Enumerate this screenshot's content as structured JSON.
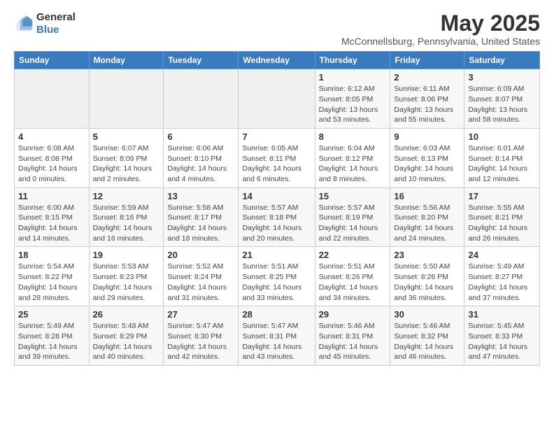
{
  "logo": {
    "general": "General",
    "blue": "Blue"
  },
  "title": "May 2025",
  "subtitle": "McConnellsburg, Pennsylvania, United States",
  "days_of_week": [
    "Sunday",
    "Monday",
    "Tuesday",
    "Wednesday",
    "Thursday",
    "Friday",
    "Saturday"
  ],
  "weeks": [
    [
      {
        "day": "",
        "info": ""
      },
      {
        "day": "",
        "info": ""
      },
      {
        "day": "",
        "info": ""
      },
      {
        "day": "",
        "info": ""
      },
      {
        "day": "1",
        "info": "Sunrise: 6:12 AM\nSunset: 8:05 PM\nDaylight: 13 hours and 53 minutes."
      },
      {
        "day": "2",
        "info": "Sunrise: 6:11 AM\nSunset: 8:06 PM\nDaylight: 13 hours and 55 minutes."
      },
      {
        "day": "3",
        "info": "Sunrise: 6:09 AM\nSunset: 8:07 PM\nDaylight: 13 hours and 58 minutes."
      }
    ],
    [
      {
        "day": "4",
        "info": "Sunrise: 6:08 AM\nSunset: 8:08 PM\nDaylight: 14 hours and 0 minutes."
      },
      {
        "day": "5",
        "info": "Sunrise: 6:07 AM\nSunset: 8:09 PM\nDaylight: 14 hours and 2 minutes."
      },
      {
        "day": "6",
        "info": "Sunrise: 6:06 AM\nSunset: 8:10 PM\nDaylight: 14 hours and 4 minutes."
      },
      {
        "day": "7",
        "info": "Sunrise: 6:05 AM\nSunset: 8:11 PM\nDaylight: 14 hours and 6 minutes."
      },
      {
        "day": "8",
        "info": "Sunrise: 6:04 AM\nSunset: 8:12 PM\nDaylight: 14 hours and 8 minutes."
      },
      {
        "day": "9",
        "info": "Sunrise: 6:03 AM\nSunset: 8:13 PM\nDaylight: 14 hours and 10 minutes."
      },
      {
        "day": "10",
        "info": "Sunrise: 6:01 AM\nSunset: 8:14 PM\nDaylight: 14 hours and 12 minutes."
      }
    ],
    [
      {
        "day": "11",
        "info": "Sunrise: 6:00 AM\nSunset: 8:15 PM\nDaylight: 14 hours and 14 minutes."
      },
      {
        "day": "12",
        "info": "Sunrise: 5:59 AM\nSunset: 8:16 PM\nDaylight: 14 hours and 16 minutes."
      },
      {
        "day": "13",
        "info": "Sunrise: 5:58 AM\nSunset: 8:17 PM\nDaylight: 14 hours and 18 minutes."
      },
      {
        "day": "14",
        "info": "Sunrise: 5:57 AM\nSunset: 8:18 PM\nDaylight: 14 hours and 20 minutes."
      },
      {
        "day": "15",
        "info": "Sunrise: 5:57 AM\nSunset: 8:19 PM\nDaylight: 14 hours and 22 minutes."
      },
      {
        "day": "16",
        "info": "Sunrise: 5:56 AM\nSunset: 8:20 PM\nDaylight: 14 hours and 24 minutes."
      },
      {
        "day": "17",
        "info": "Sunrise: 5:55 AM\nSunset: 8:21 PM\nDaylight: 14 hours and 26 minutes."
      }
    ],
    [
      {
        "day": "18",
        "info": "Sunrise: 5:54 AM\nSunset: 8:22 PM\nDaylight: 14 hours and 28 minutes."
      },
      {
        "day": "19",
        "info": "Sunrise: 5:53 AM\nSunset: 8:23 PM\nDaylight: 14 hours and 29 minutes."
      },
      {
        "day": "20",
        "info": "Sunrise: 5:52 AM\nSunset: 8:24 PM\nDaylight: 14 hours and 31 minutes."
      },
      {
        "day": "21",
        "info": "Sunrise: 5:51 AM\nSunset: 8:25 PM\nDaylight: 14 hours and 33 minutes."
      },
      {
        "day": "22",
        "info": "Sunrise: 5:51 AM\nSunset: 8:26 PM\nDaylight: 14 hours and 34 minutes."
      },
      {
        "day": "23",
        "info": "Sunrise: 5:50 AM\nSunset: 8:26 PM\nDaylight: 14 hours and 36 minutes."
      },
      {
        "day": "24",
        "info": "Sunrise: 5:49 AM\nSunset: 8:27 PM\nDaylight: 14 hours and 37 minutes."
      }
    ],
    [
      {
        "day": "25",
        "info": "Sunrise: 5:49 AM\nSunset: 8:28 PM\nDaylight: 14 hours and 39 minutes."
      },
      {
        "day": "26",
        "info": "Sunrise: 5:48 AM\nSunset: 8:29 PM\nDaylight: 14 hours and 40 minutes."
      },
      {
        "day": "27",
        "info": "Sunrise: 5:47 AM\nSunset: 8:30 PM\nDaylight: 14 hours and 42 minutes."
      },
      {
        "day": "28",
        "info": "Sunrise: 5:47 AM\nSunset: 8:31 PM\nDaylight: 14 hours and 43 minutes."
      },
      {
        "day": "29",
        "info": "Sunrise: 5:46 AM\nSunset: 8:31 PM\nDaylight: 14 hours and 45 minutes."
      },
      {
        "day": "30",
        "info": "Sunrise: 5:46 AM\nSunset: 8:32 PM\nDaylight: 14 hours and 46 minutes."
      },
      {
        "day": "31",
        "info": "Sunrise: 5:45 AM\nSunset: 8:33 PM\nDaylight: 14 hours and 47 minutes."
      }
    ]
  ]
}
